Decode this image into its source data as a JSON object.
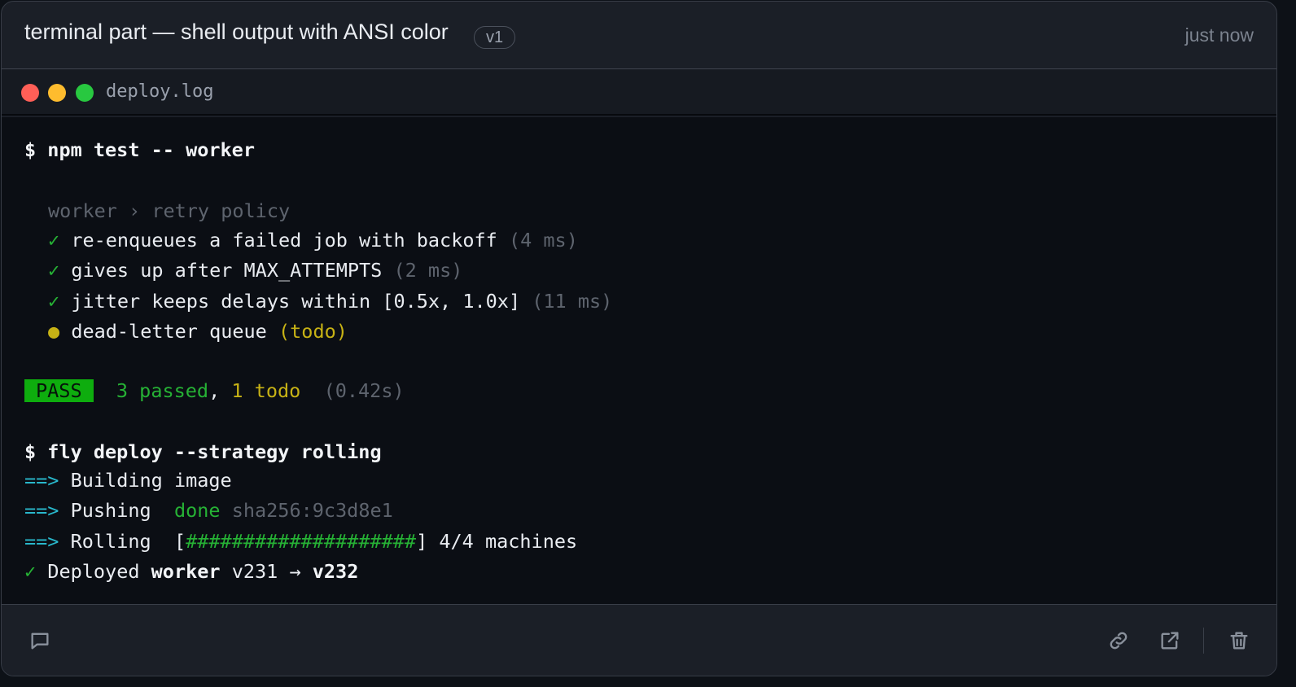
{
  "header": {
    "title": "terminal part — shell output with ANSI color",
    "version": "v1",
    "timestamp": "just now"
  },
  "tab": {
    "filename": "deploy.log"
  },
  "terminal": {
    "cmd1": "$ npm test -- worker",
    "suite": "worker › retry policy",
    "tests": [
      {
        "mark": "✓",
        "name": "re-enqueues a failed job with backoff",
        "time": "(4 ms)"
      },
      {
        "mark": "✓",
        "name": "gives up after MAX_ATTEMPTS",
        "time": "(2 ms)"
      },
      {
        "mark": "✓",
        "name": "jitter keeps delays within [0.5x, 1.0x]",
        "time": "(11 ms)"
      }
    ],
    "todo": {
      "mark": "●",
      "name": "dead-letter queue",
      "status": "(todo)"
    },
    "summary": {
      "badge": "PASS",
      "passed": "3 passed",
      "sep": ",",
      "todo": "1 todo",
      "duration": "(0.42s)"
    },
    "cmd2": "$ fly deploy --strategy rolling",
    "steps": [
      {
        "arrow": "==>",
        "text": "Building image"
      },
      {
        "arrow": "==>",
        "text": "Pushing",
        "status": "done",
        "hash": "sha256:9c3d8e1"
      },
      {
        "arrow": "==>",
        "text": "Rolling",
        "bar_open": "[",
        "bar": "####################",
        "bar_close": "]",
        "machines": "4/4 machines"
      }
    ],
    "result": {
      "mark": "✓",
      "prefix": "Deployed",
      "app": "worker",
      "from": "v231",
      "arrow": "→",
      "to": "v232"
    }
  },
  "footer": {
    "comment_icon": "comment-icon",
    "link_icon": "link-icon",
    "open_icon": "external-link-icon",
    "delete_icon": "trash-icon"
  }
}
